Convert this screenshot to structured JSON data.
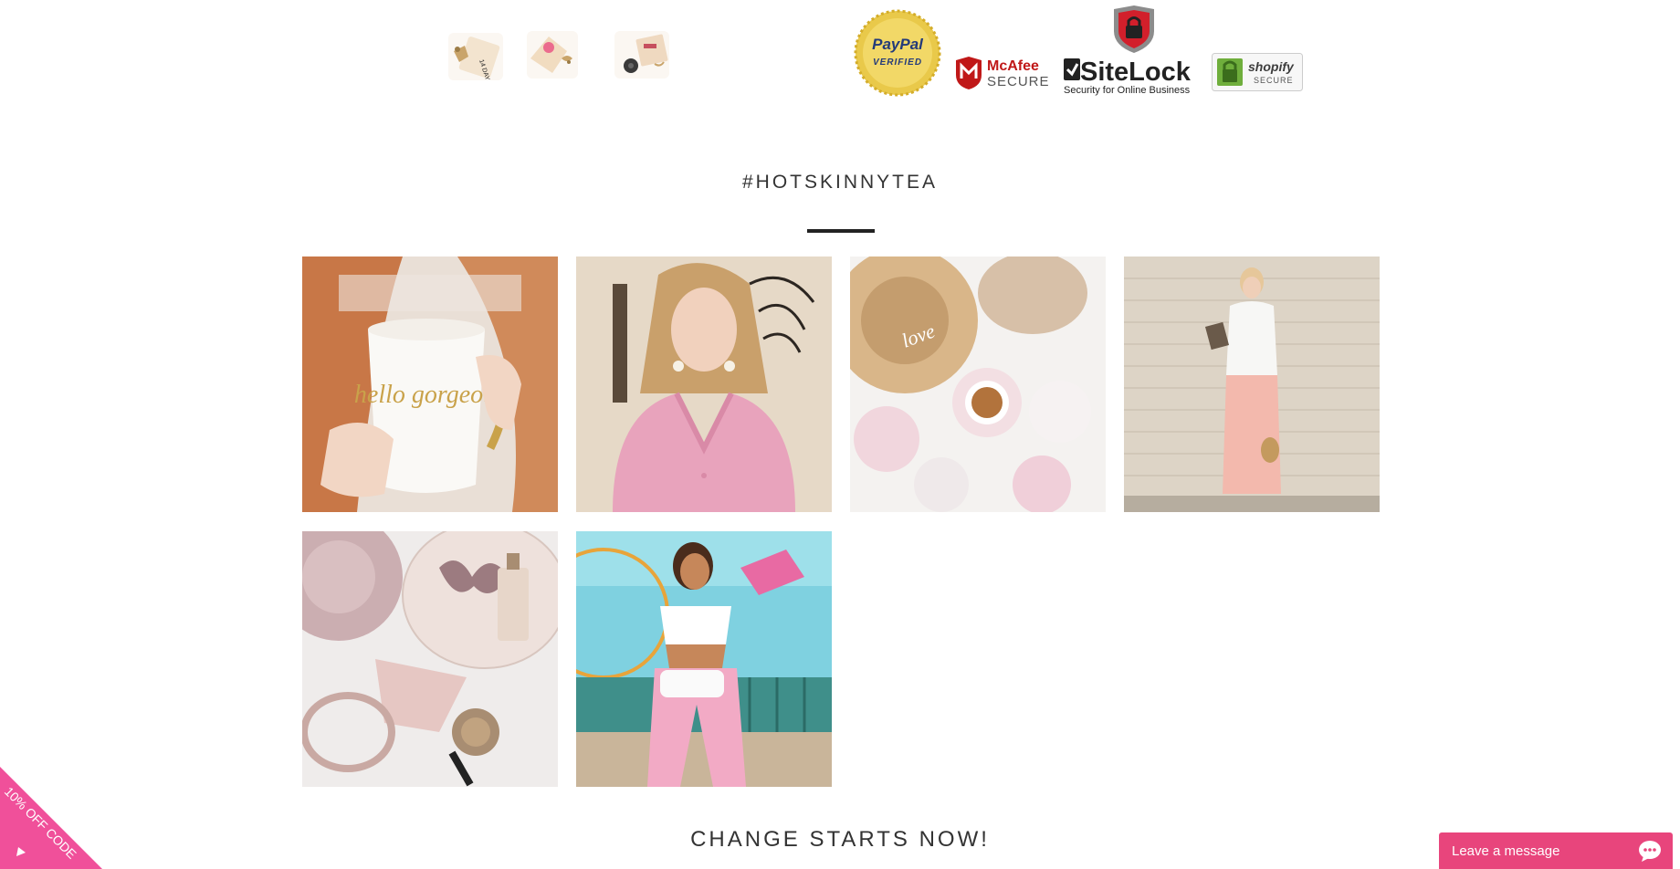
{
  "trust_badges": {
    "paypal_line1": "PayPal",
    "paypal_line2": "VERIFIED",
    "mcafee_line1": "McAfee",
    "mcafee_line2": "SECURE",
    "sitelock_line1": "SiteLock",
    "sitelock_line2": "Security for Online Business",
    "shopify_line1": "shopify",
    "shopify_line2": "SECURE"
  },
  "product_thumbs": {
    "thumb1_text": "14 DAY DETOX"
  },
  "instagram": {
    "title": "#HOTSKINNYTEA",
    "photos": [
      {
        "caption": "hello gorgeous",
        "subject": "mug-photo"
      },
      {
        "subject": "pink-cardigan-photo"
      },
      {
        "caption": "love",
        "subject": "tea-flatlay-photo"
      },
      {
        "subject": "brick-wall-outfit-photo"
      },
      {
        "subject": "perfume-flatlay-photo"
      },
      {
        "subject": "boardwalk-outfit-photo"
      }
    ]
  },
  "cta": {
    "heading": "CHANGE STARTS NOW!"
  },
  "discount_tab": {
    "label": "10% OFF CODE"
  },
  "chat": {
    "label": "Leave a message"
  },
  "colors": {
    "accent": "#e8457c",
    "text": "#333333"
  }
}
